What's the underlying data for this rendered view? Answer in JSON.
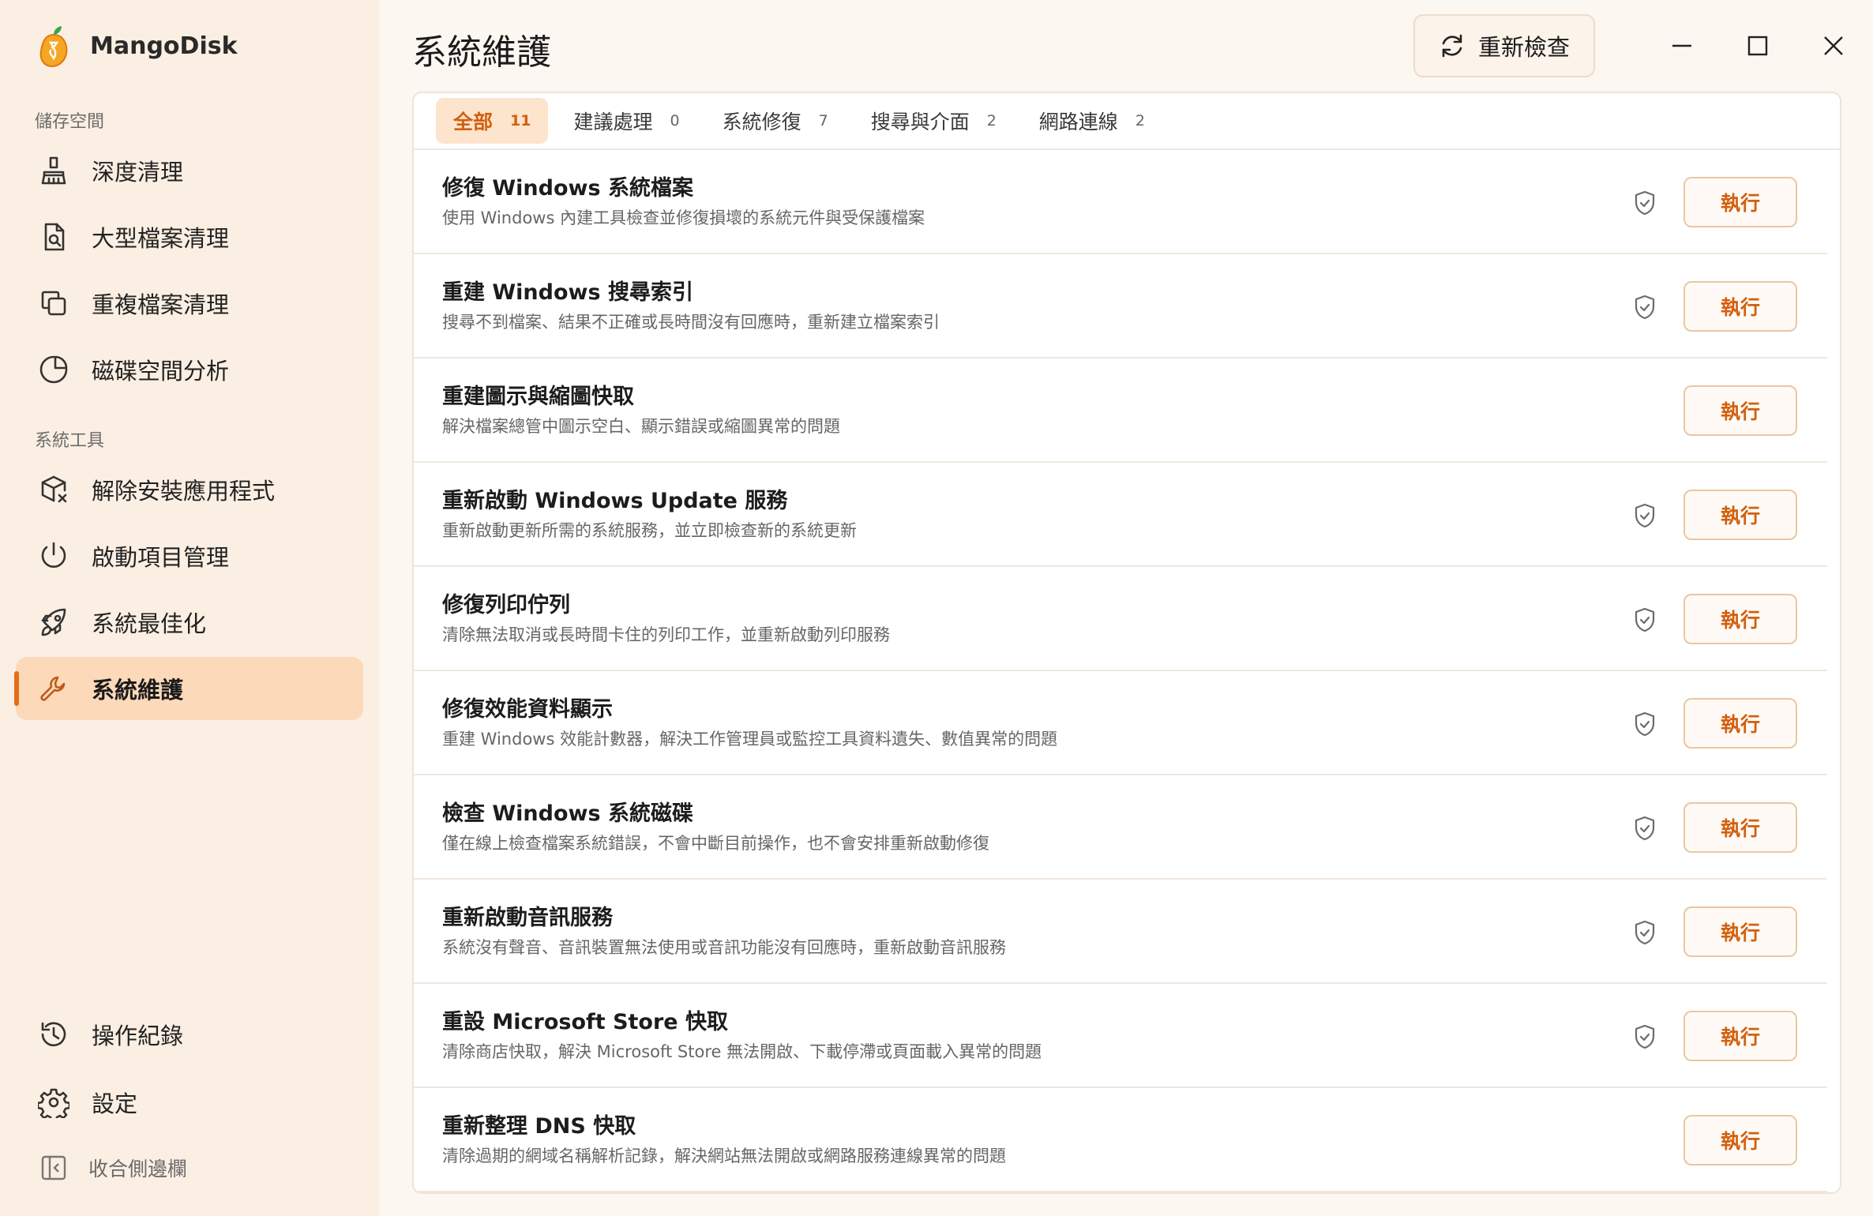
{
  "app": {
    "name": "MangoDisk"
  },
  "sidebar": {
    "storage_label": "儲存空間",
    "tools_label": "系統工具",
    "storage_items": [
      {
        "label": "深度清理",
        "icon": "broom-icon"
      },
      {
        "label": "大型檔案清理",
        "icon": "file-search-icon"
      },
      {
        "label": "重複檔案清理",
        "icon": "copy-icon"
      },
      {
        "label": "磁碟空間分析",
        "icon": "pie-chart-icon"
      }
    ],
    "tool_items": [
      {
        "label": "解除安裝應用程式",
        "icon": "package-remove-icon"
      },
      {
        "label": "啟動項目管理",
        "icon": "power-icon"
      },
      {
        "label": "系統最佳化",
        "icon": "rocket-icon"
      },
      {
        "label": "系統維護",
        "icon": "wrench-icon",
        "active": true
      }
    ],
    "bottom_items": [
      {
        "label": "操作紀錄",
        "icon": "history-icon"
      },
      {
        "label": "設定",
        "icon": "gear-icon"
      }
    ],
    "collapse_label": "收合側邊欄"
  },
  "header": {
    "title": "系統維護",
    "recheck_label": "重新檢查"
  },
  "tabs": [
    {
      "label": "全部",
      "count": "11",
      "active": true
    },
    {
      "label": "建議處理",
      "count": "0"
    },
    {
      "label": "系統修復",
      "count": "7"
    },
    {
      "label": "搜尋與介面",
      "count": "2"
    },
    {
      "label": "網路連線",
      "count": "2"
    }
  ],
  "tasks": [
    {
      "title": "修復 Windows 系統檔案",
      "desc": "使用 Windows 內建工具檢查並修復損壞的系統元件與受保護檔案",
      "admin": true,
      "action": "執行"
    },
    {
      "title": "重建 Windows 搜尋索引",
      "desc": "搜尋不到檔案、結果不正確或長時間沒有回應時，重新建立檔案索引",
      "admin": true,
      "action": "執行"
    },
    {
      "title": "重建圖示與縮圖快取",
      "desc": "解決檔案總管中圖示空白、顯示錯誤或縮圖異常的問題",
      "admin": false,
      "action": "執行"
    },
    {
      "title": "重新啟動 Windows Update 服務",
      "desc": "重新啟動更新所需的系統服務，並立即檢查新的系統更新",
      "admin": true,
      "action": "執行"
    },
    {
      "title": "修復列印佇列",
      "desc": "清除無法取消或長時間卡住的列印工作，並重新啟動列印服務",
      "admin": true,
      "action": "執行"
    },
    {
      "title": "修復效能資料顯示",
      "desc": "重建 Windows 效能計數器，解決工作管理員或監控工具資料遺失、數值異常的問題",
      "admin": true,
      "action": "執行"
    },
    {
      "title": "檢查 Windows 系統磁碟",
      "desc": "僅在線上檢查檔案系統錯誤，不會中斷目前操作，也不會安排重新啟動修復",
      "admin": true,
      "action": "執行"
    },
    {
      "title": "重新啟動音訊服務",
      "desc": "系統沒有聲音、音訊裝置無法使用或音訊功能沒有回應時，重新啟動音訊服務",
      "admin": true,
      "action": "執行"
    },
    {
      "title": "重設 Microsoft Store 快取",
      "desc": "清除商店快取，解決 Microsoft Store 無法開啟、下載停滯或頁面載入異常的問題",
      "admin": true,
      "action": "執行"
    },
    {
      "title": "重新整理 DNS 快取",
      "desc": "清除過期的網域名稱解析記錄，解決網站無法開啟或網路服務連線異常的問題",
      "admin": false,
      "action": "執行"
    }
  ],
  "colors": {
    "accent": "#e66d16",
    "active_bg": "#fcd9b9",
    "sidebar_bg": "#fbefe3"
  }
}
